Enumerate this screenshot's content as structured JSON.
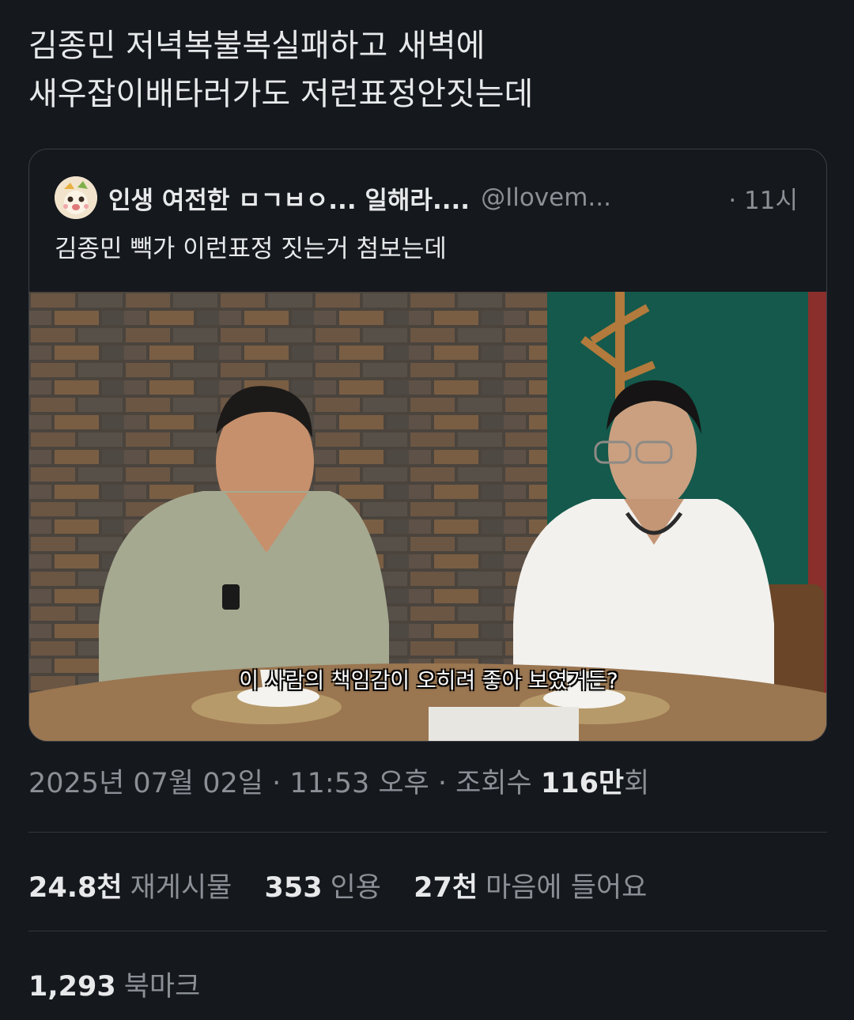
{
  "tweet": {
    "lines": [
      "김종민 저녁복불복실패하고 새벽에",
      "새우잡이배타러가도 저런표정안짓는데"
    ]
  },
  "quote": {
    "name": "인생 여전한 ㅁㄱㅂㅇ... 일해라....",
    "handle": "@Ilovem...",
    "time": "· 11시",
    "text": "김종민 빽가 이런표정 짓는거 첨보는데",
    "subtitle": "이 사람의 책임감이 오히려 좋아 보였거든?"
  },
  "meta": {
    "datetime": "2025년 07월 02일 · 11:53 오후 · 조회수 ",
    "views": "116만",
    "views_suffix": "회"
  },
  "stats": {
    "reposts": {
      "value": "24.8천",
      "label": "재게시물"
    },
    "quotes": {
      "value": "353",
      "label": "인용"
    },
    "likes": {
      "value": "27천",
      "label": "마음에 들어요"
    },
    "bookmarks": {
      "value": "1,293",
      "label": "북마크"
    }
  }
}
